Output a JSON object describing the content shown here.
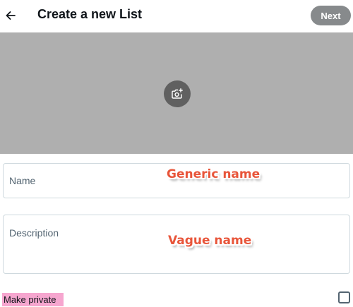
{
  "header": {
    "back_icon": "arrow-left-icon",
    "title": "Create a new List",
    "next_label": "Next"
  },
  "banner": {
    "background_color": "#afafaf",
    "add_photo_icon": "camera-plus-icon"
  },
  "form": {
    "name_label": "Name",
    "description_label": "Description",
    "make_private_label": "Make private",
    "make_private_checked": false
  },
  "annotations": {
    "name_note": "Generic name",
    "description_note": "Vague name",
    "note_color": "#e8553a",
    "highlight_color": "#f6a6cf"
  }
}
